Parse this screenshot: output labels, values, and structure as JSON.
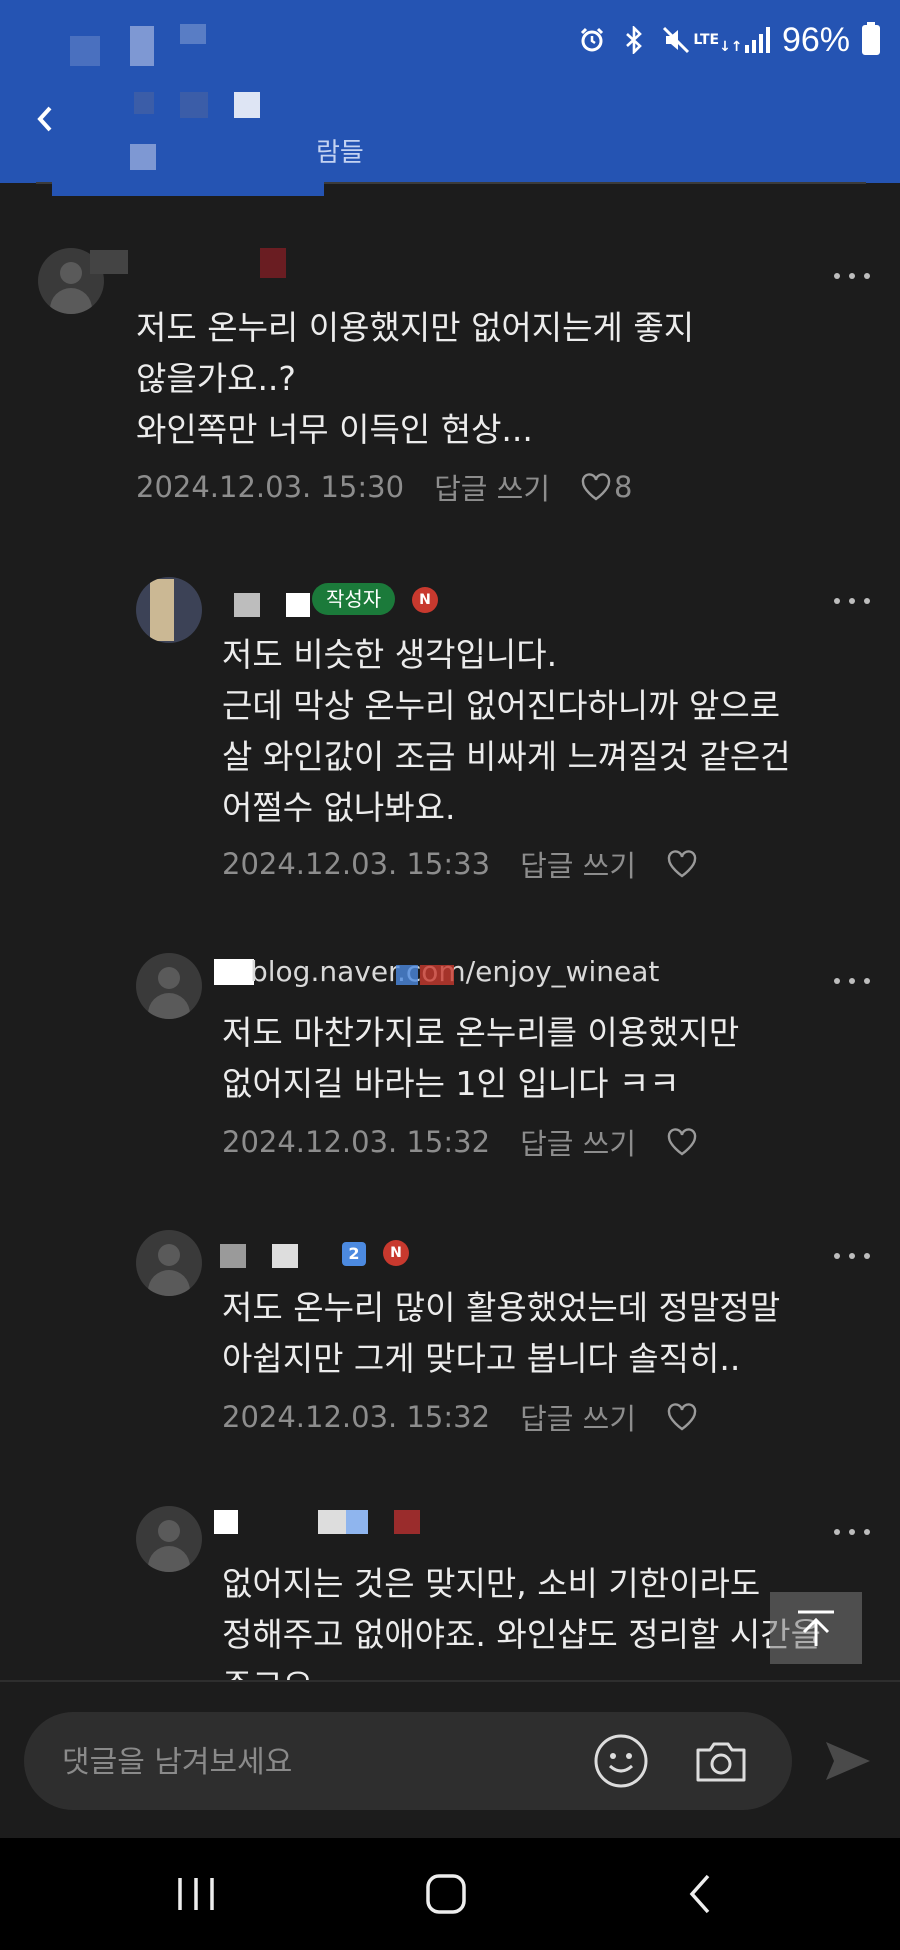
{
  "header": {
    "title_suffix": "람들"
  },
  "status_bar": {
    "battery": "96%",
    "network": "LTE"
  },
  "comments": [
    {
      "text": "저도 온누리 이용했지만 없어지는게 좋지\n않을가요..?\n와인쪽만 너무 이득인 현상...",
      "date": "2024.12.03. 15:30",
      "reply": "답글 쓰기",
      "likes": "8"
    },
    {
      "badge": "작성자",
      "text": "저도 비슷한 생각입니다.\n근데 막상 온누리 없어진다하니까 앞으로\n살 와인값이 조금 비싸게 느껴질것 같은건\n어쩔수 없나봐요.",
      "date": "2024.12.03. 15:33",
      "reply": "답글 쓰기"
    },
    {
      "link": "blog.naver.com/enjoy_wineat",
      "text": "저도 마찬가지로 온누리를 이용했지만\n없어지길 바라는 1인 입니다 ㅋㅋ",
      "date": "2024.12.03. 15:32",
      "reply": "답글 쓰기"
    },
    {
      "level": "2",
      "text": "저도 온누리 많이 활용했었는데 정말정말\n아쉽지만 그게 맞다고 봅니다 솔직히..",
      "date": "2024.12.03. 15:32",
      "reply": "답글 쓰기"
    },
    {
      "text": "없어지는 것은 맞지만, 소비 기한이라도\n정해주고 없애야죠. 와인샵도 정리할 시간을\n주고요."
    }
  ],
  "input": {
    "placeholder": "댓글을 남겨보세요"
  },
  "badge_n": "N",
  "colors": {
    "header": "#2554b3",
    "background": "#1c1c1c",
    "writer_badge": "#1b7a3a",
    "n_badge": "#c8392e"
  }
}
